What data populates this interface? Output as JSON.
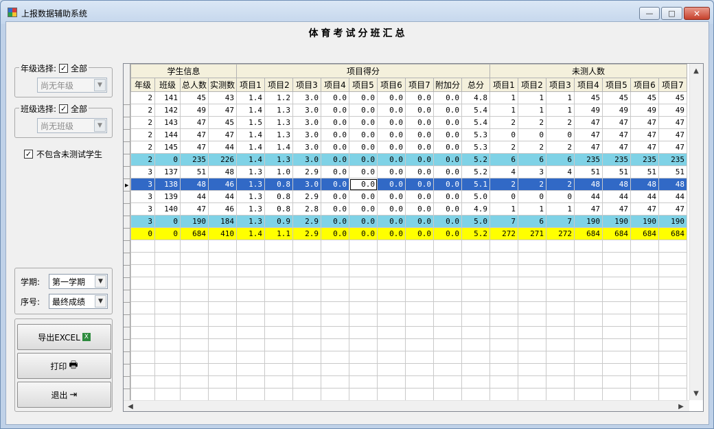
{
  "window": {
    "title": "上报数据辅助系统",
    "min": "—",
    "max": "□",
    "close": "✕"
  },
  "report_title": "体育考试分班汇总",
  "grade_group": {
    "label": "年级选择:",
    "all_label": "全部",
    "all_checked": "✓",
    "combo_value": "尚无年级"
  },
  "class_group": {
    "label": "班级选择:",
    "all_label": "全部",
    "all_checked": "✓",
    "combo_value": "尚无班级"
  },
  "exclude_untested": {
    "label": "不包含未测试学生",
    "checked": "✓"
  },
  "term": {
    "label": "学期:",
    "value": "第一学期"
  },
  "seq": {
    "label": "序号:",
    "value": "最终成绩"
  },
  "buttons": {
    "export": "导出EXCEL",
    "print": "打印",
    "exit": "退出"
  },
  "grid": {
    "groups": [
      "学生信息",
      "项目得分",
      "未测人数"
    ],
    "columns": [
      "年级",
      "班级",
      "总人数",
      "实测数",
      "项目1",
      "项目2",
      "项目3",
      "项目4",
      "项目5",
      "项目6",
      "项目7",
      "附加分",
      "总分",
      "项目1",
      "项目2",
      "项目3",
      "项目4",
      "项目5",
      "项目6",
      "项目7"
    ],
    "rows": [
      [
        "2",
        "141",
        "45",
        "43",
        "1.4",
        "1.2",
        "3.0",
        "0.0",
        "0.0",
        "0.0",
        "0.0",
        "0.0",
        "4.8",
        "1",
        "1",
        "1",
        "45",
        "45",
        "45",
        "45"
      ],
      [
        "2",
        "142",
        "49",
        "47",
        "1.4",
        "1.3",
        "3.0",
        "0.0",
        "0.0",
        "0.0",
        "0.0",
        "0.0",
        "5.4",
        "1",
        "1",
        "1",
        "49",
        "49",
        "49",
        "49"
      ],
      [
        "2",
        "143",
        "47",
        "45",
        "1.5",
        "1.3",
        "3.0",
        "0.0",
        "0.0",
        "0.0",
        "0.0",
        "0.0",
        "5.4",
        "2",
        "2",
        "2",
        "47",
        "47",
        "47",
        "47"
      ],
      [
        "2",
        "144",
        "47",
        "47",
        "1.4",
        "1.3",
        "3.0",
        "0.0",
        "0.0",
        "0.0",
        "0.0",
        "0.0",
        "5.3",
        "0",
        "0",
        "0",
        "47",
        "47",
        "47",
        "47"
      ],
      [
        "2",
        "145",
        "47",
        "44",
        "1.4",
        "1.4",
        "3.0",
        "0.0",
        "0.0",
        "0.0",
        "0.0",
        "0.0",
        "5.3",
        "2",
        "2",
        "2",
        "47",
        "47",
        "47",
        "47"
      ],
      [
        "2",
        "0",
        "235",
        "226",
        "1.4",
        "1.3",
        "3.0",
        "0.0",
        "0.0",
        "0.0",
        "0.0",
        "0.0",
        "5.2",
        "6",
        "6",
        "6",
        "235",
        "235",
        "235",
        "235"
      ],
      [
        "3",
        "137",
        "51",
        "48",
        "1.3",
        "1.0",
        "2.9",
        "0.0",
        "0.0",
        "0.0",
        "0.0",
        "0.0",
        "5.2",
        "4",
        "3",
        "4",
        "51",
        "51",
        "51",
        "51"
      ],
      [
        "3",
        "138",
        "48",
        "46",
        "1.3",
        "0.8",
        "3.0",
        "0.0",
        "0.0",
        "0.0",
        "0.0",
        "0.0",
        "5.1",
        "2",
        "2",
        "2",
        "48",
        "48",
        "48",
        "48"
      ],
      [
        "3",
        "139",
        "44",
        "44",
        "1.3",
        "0.8",
        "2.9",
        "0.0",
        "0.0",
        "0.0",
        "0.0",
        "0.0",
        "5.0",
        "0",
        "0",
        "0",
        "44",
        "44",
        "44",
        "44"
      ],
      [
        "3",
        "140",
        "47",
        "46",
        "1.3",
        "0.8",
        "2.8",
        "0.0",
        "0.0",
        "0.0",
        "0.0",
        "0.0",
        "4.9",
        "1",
        "1",
        "1",
        "47",
        "47",
        "47",
        "47"
      ],
      [
        "3",
        "0",
        "190",
        "184",
        "1.3",
        "0.9",
        "2.9",
        "0.0",
        "0.0",
        "0.0",
        "0.0",
        "0.0",
        "5.0",
        "7",
        "6",
        "7",
        "190",
        "190",
        "190",
        "190"
      ],
      [
        "0",
        "0",
        "684",
        "410",
        "1.4",
        "1.1",
        "2.9",
        "0.0",
        "0.0",
        "0.0",
        "0.0",
        "0.0",
        "5.2",
        "272",
        "271",
        "272",
        "684",
        "684",
        "684",
        "684"
      ]
    ],
    "row_styles": [
      "",
      "",
      "",
      "",
      "",
      "blue",
      "",
      "sel",
      "",
      "",
      "blue",
      "yellow"
    ],
    "empty_rows": 13,
    "selected_row": 7,
    "edit_col": 8
  }
}
